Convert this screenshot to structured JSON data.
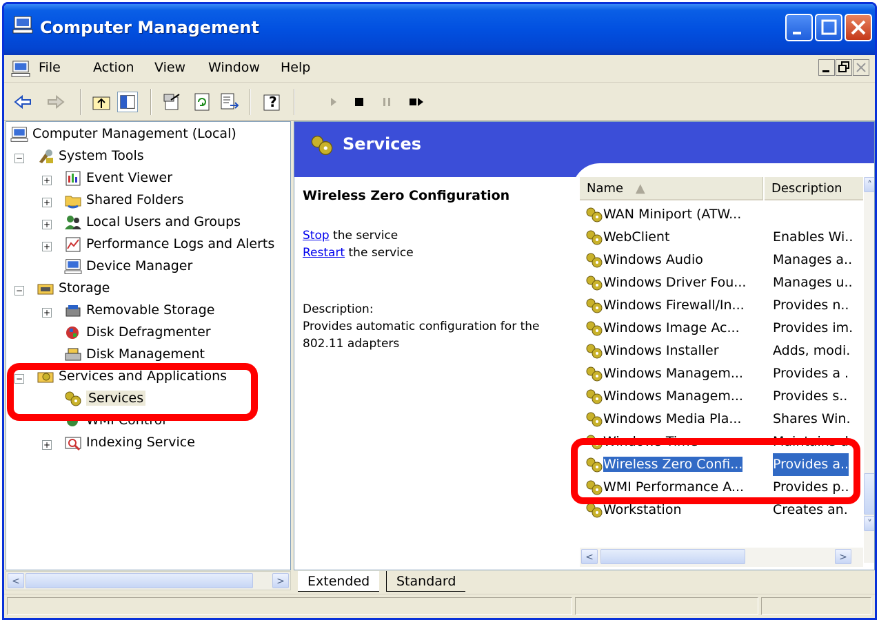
{
  "window": {
    "title": "Computer Management"
  },
  "menu": {
    "items": [
      {
        "label": "File"
      },
      {
        "label": "Action"
      },
      {
        "label": "View"
      },
      {
        "label": "Window"
      },
      {
        "label": "Help"
      }
    ]
  },
  "toolbar": {
    "icons": [
      "back-icon",
      "forward-icon",
      "up-one-level-icon",
      "show-hide-tree-icon",
      "properties-icon",
      "refresh-icon",
      "export-list-icon",
      "help-icon",
      "start-service-icon",
      "stop-service-icon",
      "pause-service-icon",
      "restart-service-icon"
    ]
  },
  "tree": {
    "root": "Computer Management (Local)",
    "system_tools": "System Tools",
    "event_viewer": "Event Viewer",
    "shared_folders": "Shared Folders",
    "local_users": "Local Users and Groups",
    "perf_logs": "Performance Logs and Alerts",
    "device_manager": "Device Manager",
    "storage": "Storage",
    "removable_storage": "Removable Storage",
    "disk_defrag": "Disk Defragmenter",
    "disk_mgmt": "Disk Management",
    "services_apps": "Services and Applications",
    "services": "Services",
    "wmi_control": "WMI Control",
    "indexing": "Indexing Service"
  },
  "header": {
    "title": "Services"
  },
  "extended": {
    "selected_service": "Wireless Zero Configuration",
    "stop_link": "Stop",
    "stop_rest": " the service",
    "restart_link": "Restart",
    "restart_rest": " the service",
    "description_label": "Description:",
    "description_line1": "Provides automatic configuration for the",
    "description_line2": "802.11 adapters"
  },
  "list": {
    "columns": {
      "name": "Name",
      "description": "Description"
    },
    "rows": [
      {
        "name": "WAN Miniport (ATW...",
        "description": ""
      },
      {
        "name": "WebClient",
        "description": "Enables Wi.."
      },
      {
        "name": "Windows Audio",
        "description": "Manages a.."
      },
      {
        "name": "Windows Driver Fou...",
        "description": "Manages u.."
      },
      {
        "name": "Windows Firewall/In...",
        "description": "Provides n.."
      },
      {
        "name": "Windows Image Ac...",
        "description": "Provides im."
      },
      {
        "name": "Windows Installer",
        "description": "Adds, modi."
      },
      {
        "name": "Windows Managem...",
        "description": "Provides a ."
      },
      {
        "name": "Windows Managem...",
        "description": "Provides s.."
      },
      {
        "name": "Windows Media Pla...",
        "description": "Shares Win."
      },
      {
        "name": "Windows Time",
        "description": "Maintains d."
      },
      {
        "name": "Wireless Zero Confi...",
        "description": "Provides a.."
      },
      {
        "name": "WMI Performance A...",
        "description": "Provides p.."
      },
      {
        "name": "Workstation",
        "description": "Creates an."
      }
    ]
  },
  "tabs": {
    "extended": "Extended",
    "standard": "Standard"
  },
  "colors": {
    "title_bar": "#0250e0",
    "header_band": "#3b4ed8",
    "selection": "#316ac5",
    "highlight_box": "#ff0000"
  }
}
